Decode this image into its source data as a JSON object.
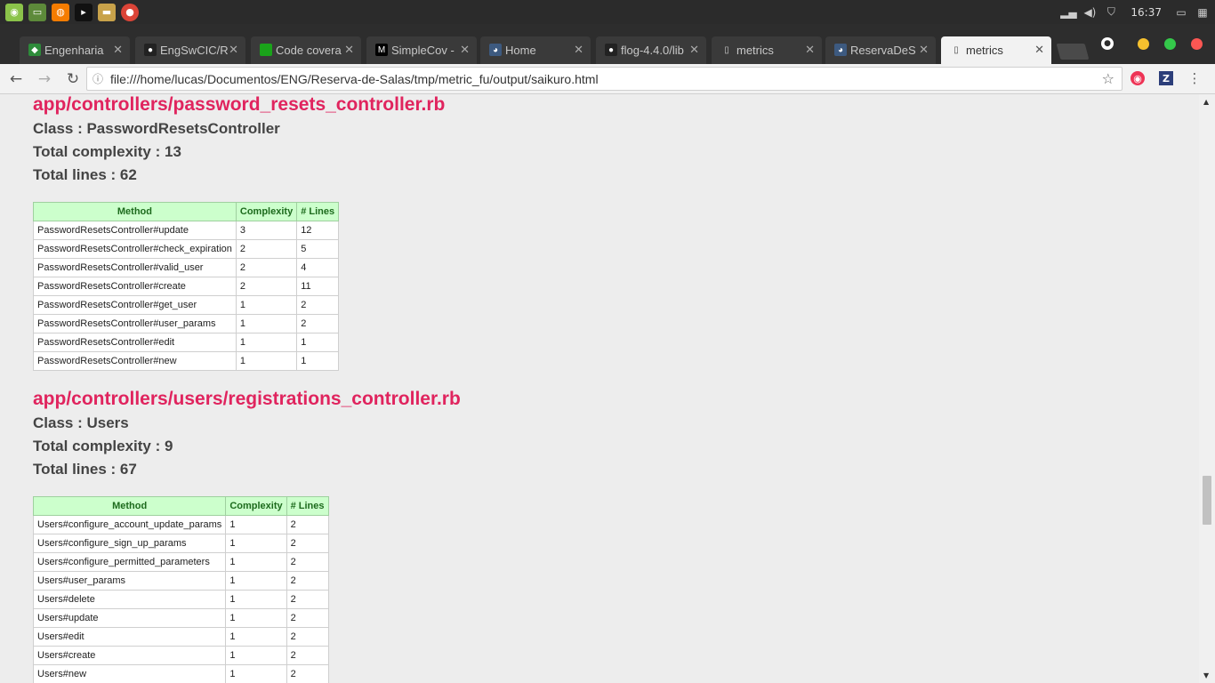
{
  "taskbar": {
    "clock": "16:37",
    "apps": [
      "mint-menu-icon",
      "files-icon",
      "firefox-icon",
      "terminal-icon",
      "folder-icon",
      "chrome-icon"
    ]
  },
  "tabs": [
    {
      "label": "Engenharia",
      "icon": "br-flag-icon",
      "active": false
    },
    {
      "label": "EngSwCIC/R",
      "icon": "github-icon",
      "active": false
    },
    {
      "label": "Code covera",
      "icon": "green-square-icon",
      "active": false
    },
    {
      "label": "SimpleCov -",
      "icon": "medium-icon",
      "active": false
    },
    {
      "label": "Home",
      "icon": "owl-icon",
      "active": false
    },
    {
      "label": "flog-4.4.0/lib",
      "icon": "github-icon",
      "active": false
    },
    {
      "label": "metrics",
      "icon": "page-icon",
      "active": false
    },
    {
      "label": "ReservaDeS",
      "icon": "owl-icon",
      "active": false
    },
    {
      "label": "metrics",
      "icon": "page-icon",
      "active": true
    }
  ],
  "address_bar": {
    "url": "file:///home/lucas/Documentos/ENG/Reserva-de-Salas/tmp/metric_fu/output/saikuro.html"
  },
  "sections": [
    {
      "file": "app/controllers/password_resets_controller.rb",
      "class_line": "Class : PasswordResetsController",
      "complexity_line": "Total complexity : 13",
      "lines_line": "Total lines : 62",
      "headers": [
        "Method",
        "Complexity",
        "# Lines"
      ],
      "rows": [
        [
          "PasswordResetsController#update",
          "3",
          "12"
        ],
        [
          "PasswordResetsController#check_expiration",
          "2",
          "5"
        ],
        [
          "PasswordResetsController#valid_user",
          "2",
          "4"
        ],
        [
          "PasswordResetsController#create",
          "2",
          "11"
        ],
        [
          "PasswordResetsController#get_user",
          "1",
          "2"
        ],
        [
          "PasswordResetsController#user_params",
          "1",
          "2"
        ],
        [
          "PasswordResetsController#edit",
          "1",
          "1"
        ],
        [
          "PasswordResetsController#new",
          "1",
          "1"
        ]
      ]
    },
    {
      "file": "app/controllers/users/registrations_controller.rb",
      "class_line": "Class : Users",
      "complexity_line": "Total complexity : 9",
      "lines_line": "Total lines : 67",
      "headers": [
        "Method",
        "Complexity",
        "# Lines"
      ],
      "rows": [
        [
          "Users#configure_account_update_params",
          "1",
          "2"
        ],
        [
          "Users#configure_sign_up_params",
          "1",
          "2"
        ],
        [
          "Users#configure_permitted_parameters",
          "1",
          "2"
        ],
        [
          "Users#user_params",
          "1",
          "2"
        ],
        [
          "Users#delete",
          "1",
          "2"
        ],
        [
          "Users#update",
          "1",
          "2"
        ],
        [
          "Users#edit",
          "1",
          "2"
        ],
        [
          "Users#create",
          "1",
          "2"
        ],
        [
          "Users#new",
          "1",
          "2"
        ]
      ]
    }
  ]
}
